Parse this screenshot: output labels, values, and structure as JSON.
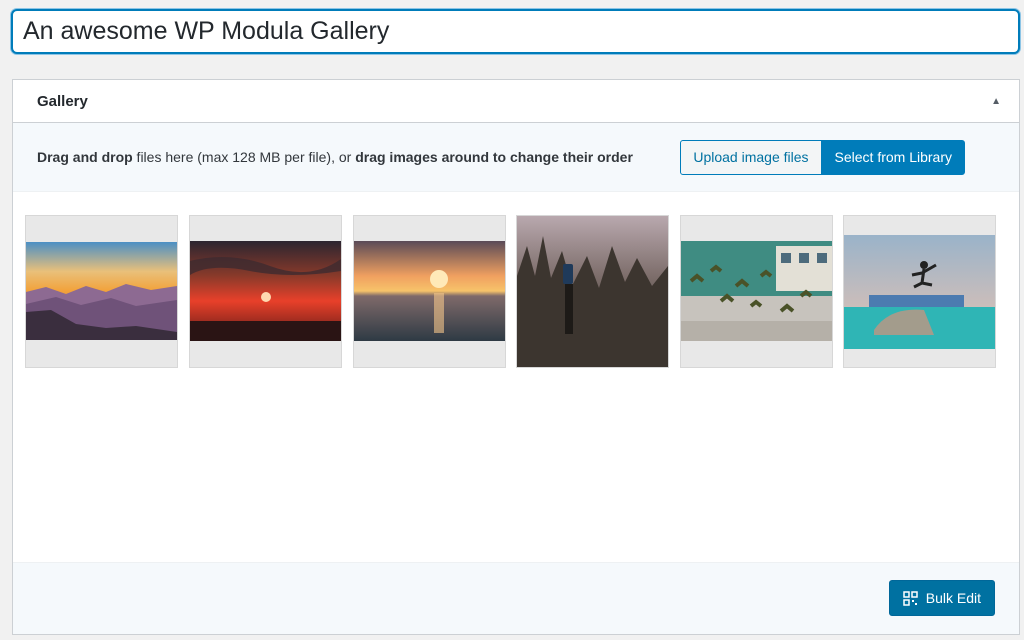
{
  "title": {
    "value": "An awesome WP Modula Gallery"
  },
  "postbox": {
    "title": "Gallery",
    "toggle_icon": "triangle-up-icon"
  },
  "upload": {
    "help_part1": "Drag and drop",
    "help_part2": " files here (max 128 MB per file), or ",
    "help_part3": "drag images around to change their order",
    "upload_button": "Upload image files",
    "library_button": "Select from Library"
  },
  "gallery": {
    "images": [
      {
        "name": "mountain-sunset-image"
      },
      {
        "name": "red-sunset-image"
      },
      {
        "name": "ocean-sunset-image"
      },
      {
        "name": "field-phone-image"
      },
      {
        "name": "birds-building-image"
      },
      {
        "name": "skater-jump-image"
      }
    ]
  },
  "footer": {
    "bulk_edit_label": "Bulk Edit",
    "bulk_edit_icon": "grid-edit-icon"
  },
  "colors": {
    "accent": "#007cba",
    "primary_button": "#0071a1"
  }
}
